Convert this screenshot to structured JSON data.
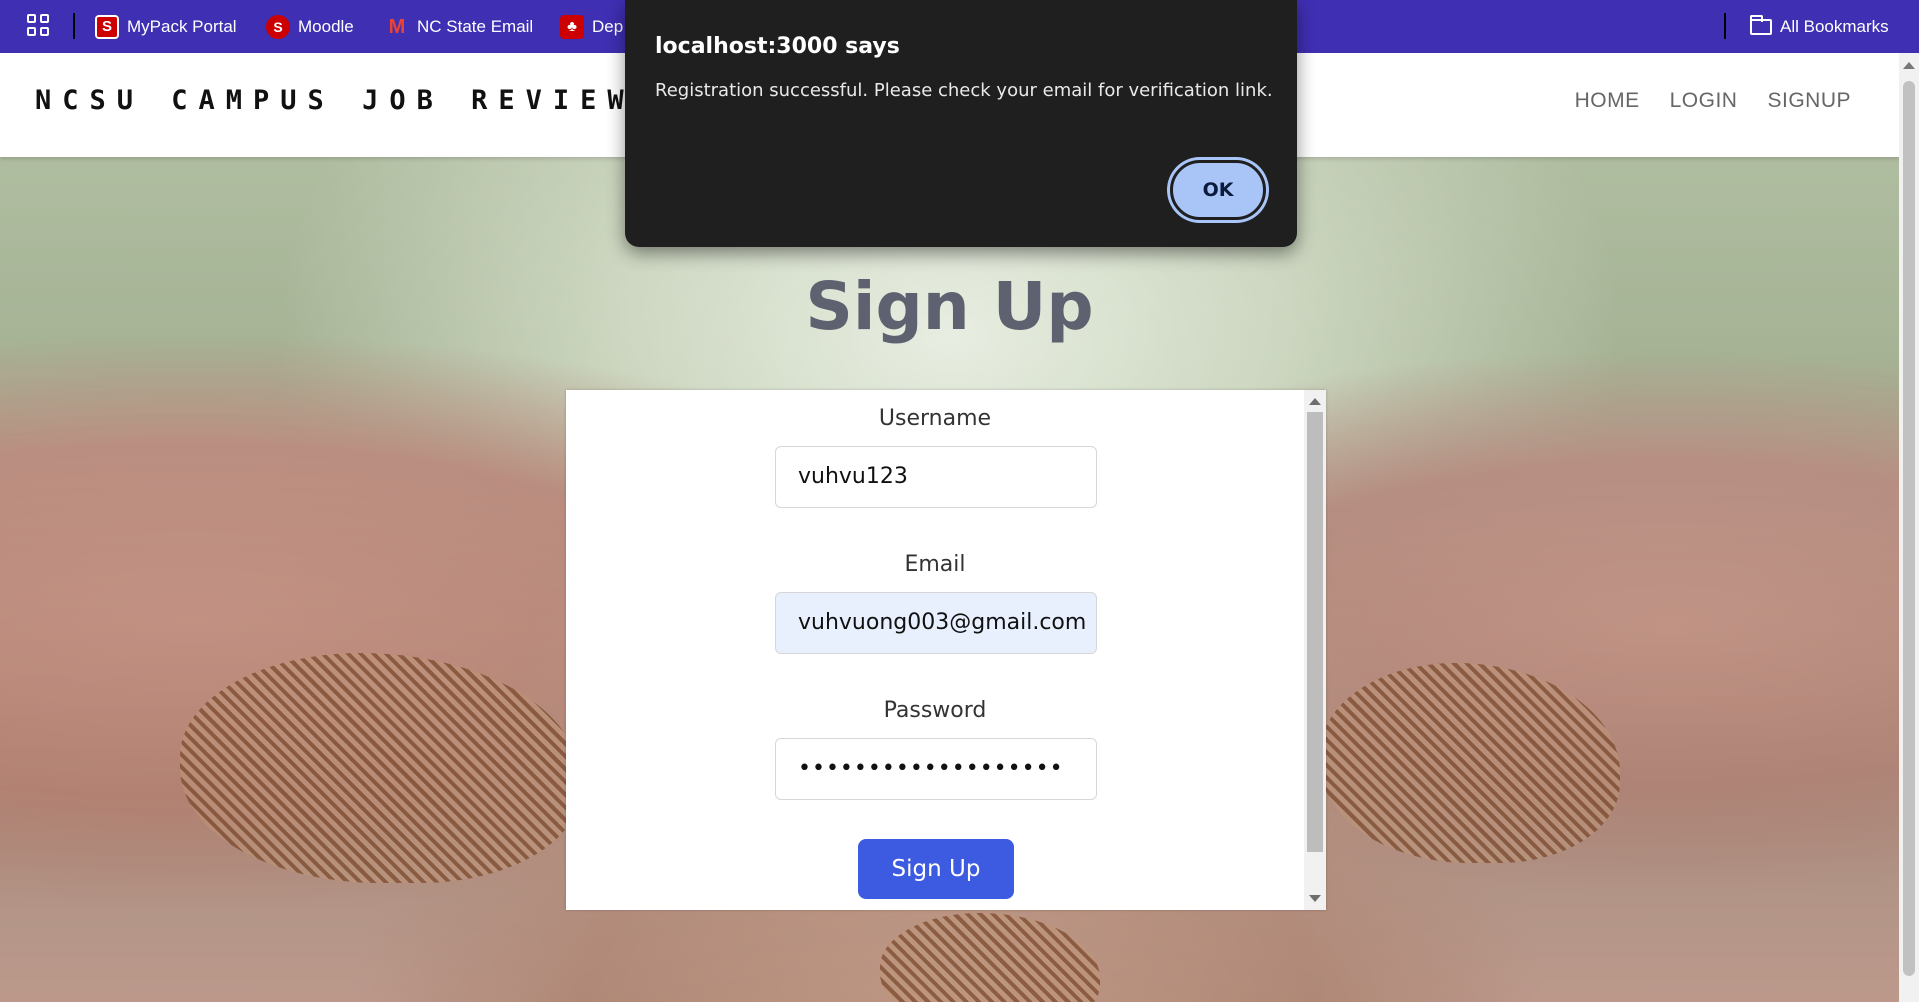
{
  "bookmarks": {
    "items": [
      {
        "label": "MyPack Portal",
        "icon": "ncsu-logo-icon"
      },
      {
        "label": "Moodle",
        "icon": "moodle-logo-icon"
      },
      {
        "label": "NC State Email",
        "icon": "gmail-icon"
      },
      {
        "label": "Dep",
        "icon": "wolf-logo-icon"
      }
    ],
    "all_bookmarks": "All Bookmarks"
  },
  "header": {
    "brand": "NCSU CAMPUS JOB REVIEW",
    "nav": [
      "HOME",
      "LOGIN",
      "SIGNUP"
    ]
  },
  "signup": {
    "title": "Sign Up",
    "username_label": "Username",
    "username_value": "vuhvu123",
    "email_label": "Email",
    "email_value": "vuhvuong003@gmail.com",
    "password_label": "Password",
    "password_value": "•••••••••••••••••••",
    "button": "Sign Up"
  },
  "dialog": {
    "title": "localhost:3000 says",
    "message": "Registration successful. Please check your email for verification link.",
    "ok": "OK"
  },
  "colors": {
    "bookmark_bar": "#3f2fb3",
    "signup_button": "#3d5be0",
    "dialog_bg": "#1f1f1f",
    "ok_button": "#a9c5f8"
  }
}
